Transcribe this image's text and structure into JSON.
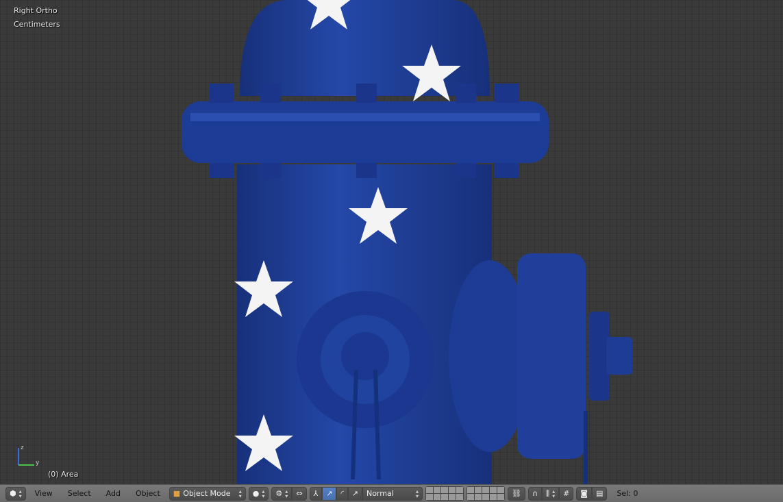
{
  "viewport": {
    "view_name": "Right Ortho",
    "units": "Centimeters",
    "object_info": "(0) Area",
    "axis_labels": {
      "z": "z",
      "y": "y"
    }
  },
  "toolbar": {
    "editor_icon": "3d-view-cube-icon",
    "menus": [
      "View",
      "Select",
      "Add",
      "Object"
    ],
    "mode": "Object Mode",
    "shading_icon": "sphere-shading-icon",
    "pivot_icon": "pivot-icon",
    "orientation": "Normal",
    "selection": "Sel: 0"
  },
  "colors": {
    "hydrant": "#1f3f9a",
    "star": "#f4f4f4",
    "accent": "#5680c2"
  }
}
